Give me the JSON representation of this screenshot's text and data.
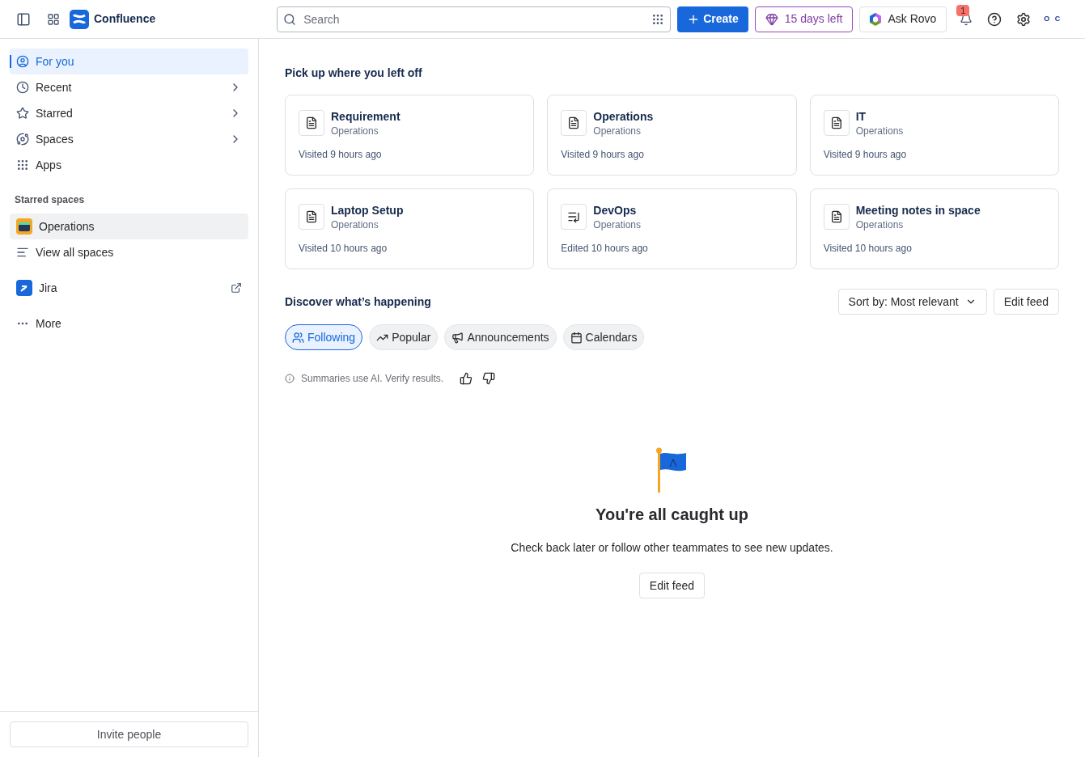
{
  "topbar": {
    "app_name": "Confluence",
    "search": {
      "placeholder": "Search"
    },
    "create": "Create",
    "trial": "15 days left",
    "ask": "Ask Rovo",
    "notifications": "1",
    "avatar": "O C"
  },
  "sidebar": {
    "items": [
      {
        "label": "For you",
        "kind": "link",
        "selected": true
      },
      {
        "label": "Recent",
        "kind": "menu",
        "selected": false
      },
      {
        "label": "Starred",
        "kind": "menu",
        "selected": false
      },
      {
        "label": "Spaces",
        "kind": "menu",
        "selected": false
      },
      {
        "label": "Apps",
        "kind": "link",
        "selected": false
      }
    ],
    "starred_heading": "Starred spaces",
    "spaces": [
      {
        "label": "Operations",
        "selected": true
      },
      {
        "label": "View all spaces",
        "selected": false
      }
    ],
    "apps": [
      {
        "label": "Jira",
        "kind": "external"
      },
      {
        "label": "More",
        "kind": "more"
      }
    ],
    "invite": "Invite people"
  },
  "recent": {
    "title": "Pick up where you left off",
    "cards": [
      {
        "title": "Requirement",
        "space": "Operations",
        "time": "Visited 9 hours ago",
        "kind": "page"
      },
      {
        "title": "Operations",
        "space": "Operations",
        "time": "Visited 9 hours ago",
        "kind": "page"
      },
      {
        "title": "IT",
        "space": "Operations",
        "time": "Visited 9 hours ago",
        "kind": "page"
      },
      {
        "title": "Laptop Setup",
        "space": "Operations",
        "time": "Visited 10 hours ago",
        "kind": "page"
      },
      {
        "title": "DevOps",
        "space": "Operations",
        "time": "Edited 10 hours ago",
        "kind": "list"
      },
      {
        "title": "Meeting notes in space",
        "space": "Operations",
        "time": "Visited 10 hours ago",
        "kind": "page"
      }
    ]
  },
  "feed": {
    "title": "Discover what’s happening",
    "sort": "Sort by: Most relevant",
    "edit": "Edit feed",
    "tabs": [
      {
        "label": "Following",
        "selected": true
      },
      {
        "label": "Popular",
        "selected": false
      },
      {
        "label": "Announcements",
        "selected": false
      },
      {
        "label": "Calendars",
        "selected": false
      }
    ],
    "notice": "Summaries use AI. Verify results.",
    "empty": {
      "title": "You're all caught up",
      "text": "Check back later or follow other teammates to see new updates.",
      "button": "Edit feed"
    }
  }
}
